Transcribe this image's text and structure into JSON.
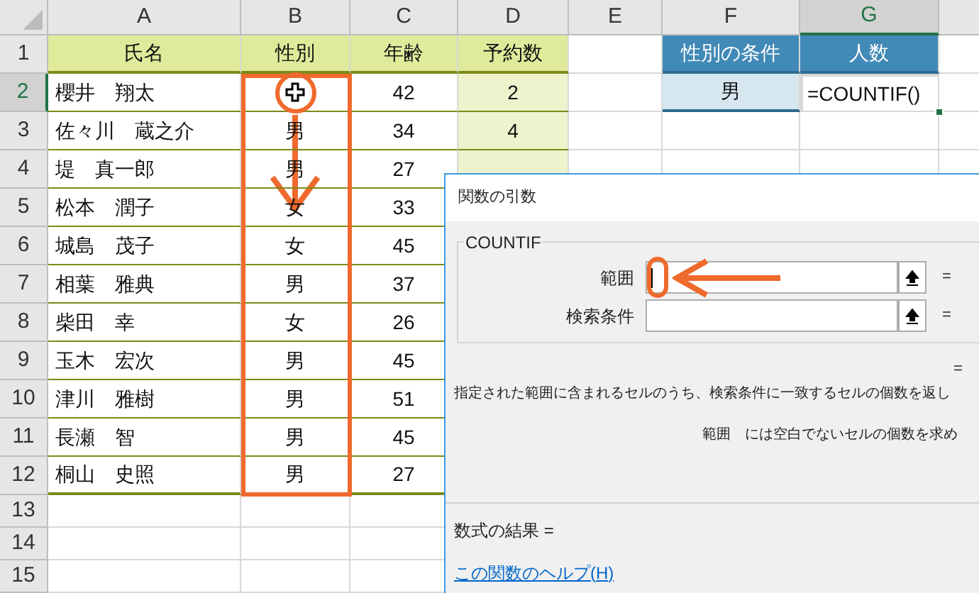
{
  "sheet": {
    "columns": [
      {
        "label": "A",
        "selected": false
      },
      {
        "label": "B",
        "selected": false
      },
      {
        "label": "C",
        "selected": false
      },
      {
        "label": "D",
        "selected": false
      },
      {
        "label": "E",
        "selected": false
      },
      {
        "label": "F",
        "selected": false
      },
      {
        "label": "G",
        "selected": true
      }
    ],
    "rows": [
      {
        "number": "1",
        "selected": false,
        "cells": {
          "A": "氏名",
          "B": "性別",
          "C": "年齢",
          "D": "予約数",
          "F": "性別の条件",
          "G": "人数"
        }
      },
      {
        "number": "2",
        "selected": true,
        "cells": {
          "A": "櫻井　翔太",
          "C": "42",
          "D": "2",
          "F": "男",
          "G": "=COUNTIF()"
        }
      },
      {
        "number": "3",
        "selected": false,
        "cells": {
          "A": "佐々川　蔵之介",
          "B": "男",
          "C": "34",
          "D": "4"
        }
      },
      {
        "number": "4",
        "selected": false,
        "cells": {
          "A": "堤　真一郎",
          "B": "男",
          "C": "27"
        }
      },
      {
        "number": "5",
        "selected": false,
        "cells": {
          "A": "松本　潤子",
          "B": "女",
          "C": "33"
        }
      },
      {
        "number": "6",
        "selected": false,
        "cells": {
          "A": "城島　茂子",
          "B": "女",
          "C": "45"
        }
      },
      {
        "number": "7",
        "selected": false,
        "cells": {
          "A": "相葉　雅典",
          "B": "男",
          "C": "37"
        }
      },
      {
        "number": "8",
        "selected": false,
        "cells": {
          "A": "柴田　幸",
          "B": "女",
          "C": "26"
        }
      },
      {
        "number": "9",
        "selected": false,
        "cells": {
          "A": "玉木　宏次",
          "B": "男",
          "C": "45"
        }
      },
      {
        "number": "10",
        "selected": false,
        "cells": {
          "A": "津川　雅樹",
          "B": "男",
          "C": "51"
        }
      },
      {
        "number": "11",
        "selected": false,
        "cells": {
          "A": "長瀬　智",
          "B": "男",
          "C": "45"
        }
      },
      {
        "number": "12",
        "selected": false,
        "cells": {
          "A": "桐山　史照",
          "B": "男",
          "C": "27"
        }
      },
      {
        "number": "13",
        "selected": false,
        "cells": {}
      },
      {
        "number": "14",
        "selected": false,
        "cells": {}
      },
      {
        "number": "15",
        "selected": false,
        "cells": {}
      }
    ]
  },
  "dialog": {
    "title": "関数の引数",
    "function_name": "COUNTIF",
    "arguments": [
      {
        "label": "範囲",
        "focused": true,
        "equals": "="
      },
      {
        "label": "検索条件",
        "focused": false,
        "equals": "="
      }
    ],
    "value_equals": "=",
    "description": "指定された範囲に含まれるセルのうち、検索条件に一致するセルの個数を返し",
    "argument_help": "範囲　には空白でないセルの個数を求め",
    "result_label": "数式の結果 =",
    "help_link": "この関数のヘルプ(H)"
  }
}
